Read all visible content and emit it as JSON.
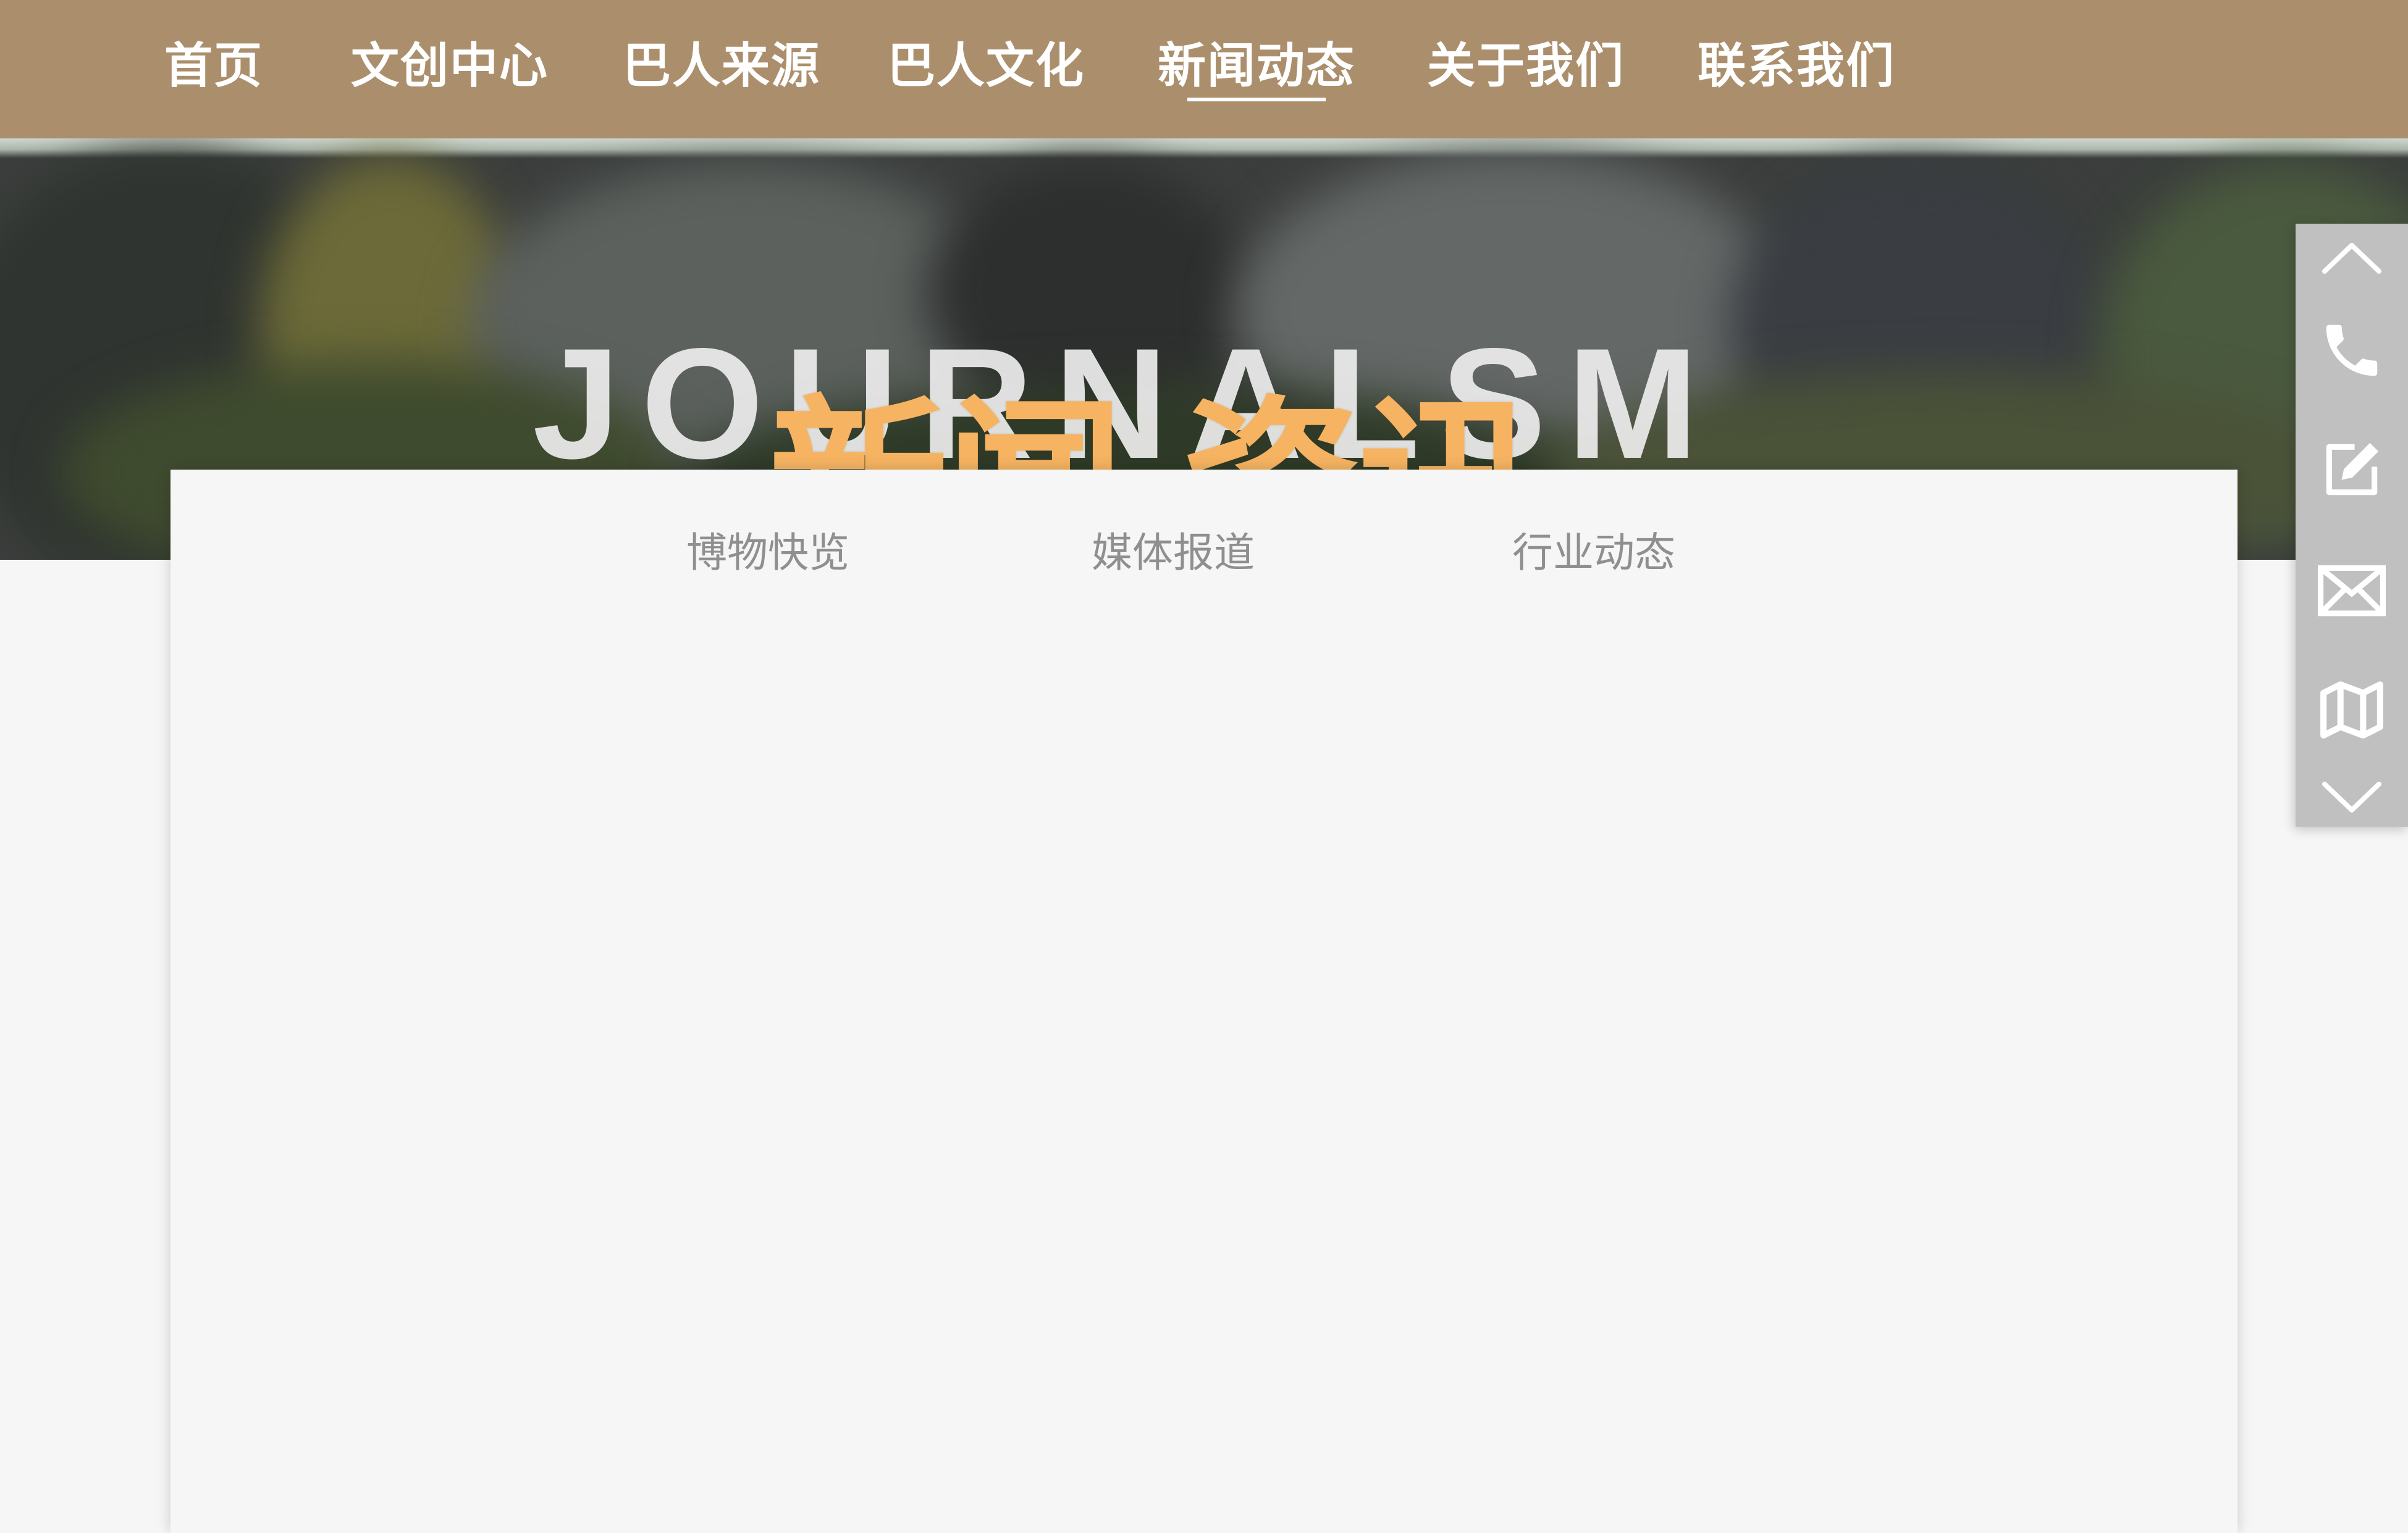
{
  "nav": {
    "items": [
      {
        "label": "首页"
      },
      {
        "label": "文创中心"
      },
      {
        "label": "巴人来源"
      },
      {
        "label": "巴人文化"
      },
      {
        "label": "新闻动态",
        "active": true
      },
      {
        "label": "关于我们"
      },
      {
        "label": "联系我们"
      }
    ],
    "background_color": "#ab8f6c"
  },
  "hero": {
    "title_en": "JOURNALSM",
    "title_cn": "新闻 资讯",
    "accent_color": "#f6b462"
  },
  "subtabs": [
    {
      "label": "博物快览"
    },
    {
      "label": "媒体报道"
    },
    {
      "label": "行业动态"
    }
  ],
  "sidebar": {
    "icons": [
      "chevron-up-icon",
      "phone-icon",
      "edit-icon",
      "mail-icon",
      "map-icon",
      "chevron-down-icon"
    ]
  }
}
